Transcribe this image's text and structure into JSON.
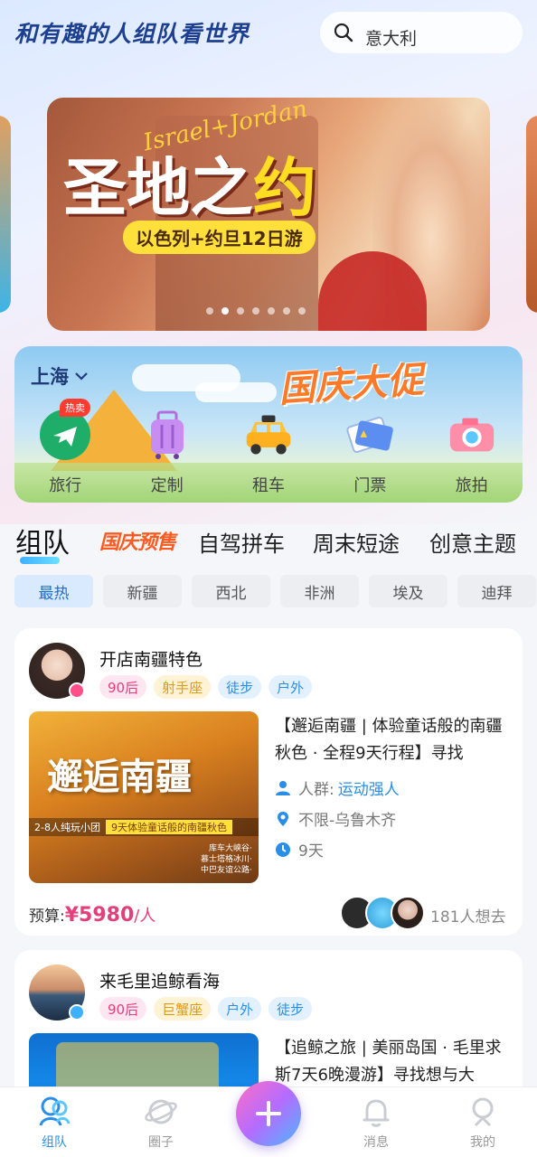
{
  "header": {
    "slogan": "和有趣的人组队看世界",
    "search_text": "意大利"
  },
  "banner": {
    "script_text": "Israel+Jordan",
    "title_part1": "圣地之",
    "title_part2": "约",
    "subtitle": "以色列+约旦12日游",
    "dot_count": 7,
    "active_dot": 1
  },
  "promo": {
    "city": "上海",
    "title": "国庆大促",
    "categories": [
      {
        "label": "旅行",
        "icon": "plane-icon",
        "badge": "热卖"
      },
      {
        "label": "定制",
        "icon": "suitcase-icon"
      },
      {
        "label": "租车",
        "icon": "taxi-icon"
      },
      {
        "label": "门票",
        "icon": "ticket-icon"
      },
      {
        "label": "旅拍",
        "icon": "camera-icon"
      }
    ]
  },
  "tabs": {
    "items": [
      "组队",
      "国庆预售",
      "自驾拼车",
      "周末短途",
      "创意主题"
    ],
    "active": 0
  },
  "filters": {
    "items": [
      "最热",
      "新疆",
      "西北",
      "非洲",
      "埃及",
      "迪拜"
    ],
    "active": 0
  },
  "cards": [
    {
      "title": "开店南疆特色",
      "tags": [
        "90后",
        "射手座",
        "徒步",
        "户外"
      ],
      "cover_title": "邂逅南疆",
      "cover_banner_left": "2-8人纯玩小团",
      "cover_banner_right": "9天体验童话般的南疆秋色",
      "cover_places": "库车大峡谷·\n慕士塔格冰川·\n中巴友谊公路·",
      "description": "【邂逅南疆 | 体验童话般的南疆秋色 · 全程9天行程】寻找",
      "crowd_label": "人群:",
      "crowd_value": "运动强人",
      "location": "不限-乌鲁木齐",
      "duration": "9天",
      "budget_label": "预算:",
      "budget_price": "¥5980",
      "budget_unit": "/人",
      "want_count": "181人想去"
    },
    {
      "title": "来毛里追鲸看海",
      "tags": [
        "90后",
        "巨蟹座",
        "户外",
        "徒步"
      ],
      "description": "【追鲸之旅 | 美丽岛国 · 毛里求斯7天6晚漫游】寻找想与大"
    }
  ],
  "bottom_nav": {
    "items": [
      {
        "label": "组队",
        "icon": "team-icon"
      },
      {
        "label": "圈子",
        "icon": "planet-icon"
      },
      {
        "label": "消息",
        "icon": "bell-icon"
      },
      {
        "label": "我的",
        "icon": "profile-icon"
      }
    ],
    "active": 0,
    "fab_icon": "plus-icon"
  },
  "colors": {
    "accent": "#2a8ee6",
    "price": "#e2407b",
    "slogan": "#1d3f8f"
  }
}
